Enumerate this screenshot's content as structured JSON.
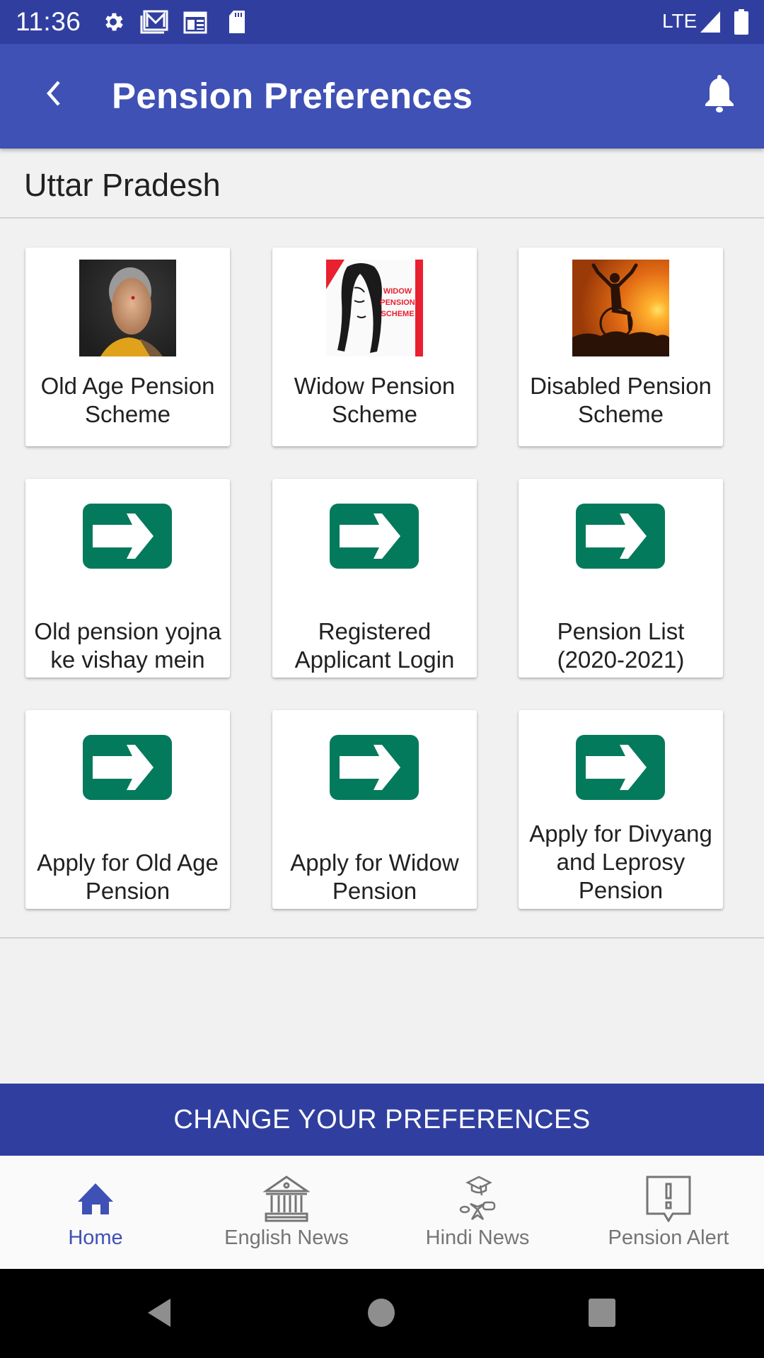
{
  "status_bar": {
    "time": "11:36",
    "left_icons": [
      "gear-icon",
      "gmail-icon",
      "calendar-icon",
      "sd-card-icon"
    ],
    "network": "LTE",
    "right_icons": [
      "signal-icon",
      "battery-icon"
    ]
  },
  "app_bar": {
    "title": "Pension Preferences",
    "back_icon": "chevron-left-icon",
    "action_icon": "bell-icon"
  },
  "location": "Uttar Pradesh",
  "colors": {
    "primary": "#3F51B5",
    "primary_dark": "#303F9F",
    "arrow_green": "#047A5C",
    "background": "#F1F1F1"
  },
  "cards": [
    {
      "label": "Old Age Pension Scheme",
      "icon": "elderly-woman-photo"
    },
    {
      "label": "Widow Pension Scheme",
      "icon": "widow-pension-scheme-image",
      "image_text": [
        "WIDOW",
        "PENSION",
        "SCHEME"
      ]
    },
    {
      "label": "Disabled Pension Scheme",
      "icon": "wheelchair-sunset-photo"
    },
    {
      "label": "Old pension yojna ke vishay mein",
      "icon": "arrow-right-icon"
    },
    {
      "label": "Registered Applicant Login",
      "icon": "arrow-right-icon"
    },
    {
      "label": "Pension List (2020-2021)",
      "icon": "arrow-right-icon"
    },
    {
      "label": "Apply for Old Age Pension",
      "icon": "arrow-right-icon"
    },
    {
      "label": "Apply for Widow Pension",
      "icon": "arrow-right-icon"
    },
    {
      "label": "Apply for Divyang and Leprosy Pension",
      "icon": "arrow-right-icon"
    }
  ],
  "cta": {
    "label": "CHANGE YOUR PREFERENCES"
  },
  "bottom_nav": [
    {
      "label": "Home",
      "icon": "home-icon",
      "active": true
    },
    {
      "label": "English News",
      "icon": "bank-building-icon",
      "active": false
    },
    {
      "label": "Hindi News",
      "icon": "graduation-scroll-icon",
      "active": false
    },
    {
      "label": "Pension Alert",
      "icon": "alert-bubble-icon",
      "active": false
    }
  ],
  "system_nav": [
    "back-icon",
    "home-icon",
    "recents-icon"
  ]
}
